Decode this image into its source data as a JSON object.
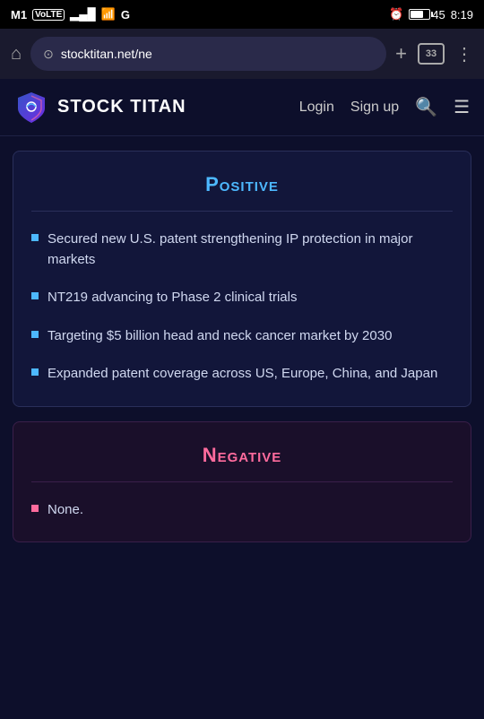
{
  "status_bar": {
    "carrier": "M1",
    "carrier_type": "VoLTE",
    "signal_bars": "▂▄▆",
    "wifi": "WiFi",
    "g_icon": "G",
    "alarm": "⏰",
    "battery_pct": "45",
    "time": "8:19"
  },
  "browser": {
    "url": "stocktitan.net/ne",
    "tab_count": "33",
    "home_icon": "⌂",
    "add_icon": "+"
  },
  "nav": {
    "logo_text": "STOCK TITAN",
    "login_label": "Login",
    "signup_label": "Sign up",
    "search_icon": "🔍",
    "menu_icon": "☰"
  },
  "positive": {
    "title": "Positive",
    "bullets": [
      "Secured new U.S. patent strengthening IP protection in major markets",
      "NT219 advancing to Phase 2 clinical trials",
      "Targeting $5 billion head and neck cancer market by 2030",
      "Expanded patent coverage across US, Europe, China, and Japan"
    ]
  },
  "negative": {
    "title": "Negative",
    "bullets": [
      "None."
    ]
  }
}
